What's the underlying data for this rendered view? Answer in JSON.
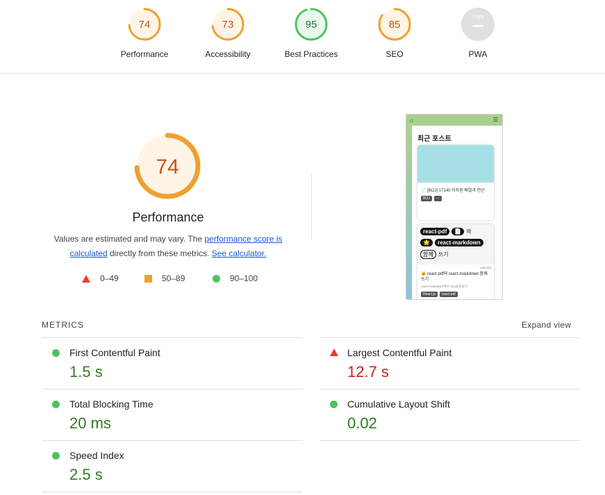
{
  "categories": [
    {
      "label": "Performance",
      "score": "74",
      "level": 0.74,
      "color": "#f0a030",
      "text_color": "#c0561b",
      "fill": "#fff4e6"
    },
    {
      "label": "Accessibility",
      "score": "73",
      "level": 0.73,
      "color": "#f0a030",
      "text_color": "#c0561b",
      "fill": "#fff4e6"
    },
    {
      "label": "Best Practices",
      "score": "95",
      "level": 0.95,
      "color": "#4dc45f",
      "text_color": "#1e7a35",
      "fill": "#e9f8ec"
    },
    {
      "label": "SEO",
      "score": "85",
      "level": 0.85,
      "color": "#f0a030",
      "text_color": "#c0561b",
      "fill": "#fff4e6"
    },
    {
      "label": "PWA",
      "badge": "PWA",
      "color": "#bdbdbd"
    }
  ],
  "hero": {
    "score": "74",
    "title": "Performance",
    "desc_prefix": "Values are estimated and may vary. The ",
    "desc_link": "performance score is calculated",
    "desc_middle": " directly from these metrics. ",
    "desc_link2": "See calculator."
  },
  "legend": {
    "fail": "0–49",
    "average": "50–89",
    "pass": "90–100"
  },
  "thumbnail": {
    "heading": "최근 포스트",
    "card1_title": "📄 [BOJ] 17140 이차원 배열과 연산",
    "card1_tags": [
      "BOJ",
      "···"
    ],
    "card2_pills": [
      "react-pdf",
      "📄",
      "와"
    ],
    "card2_pills2": [
      "🌟",
      "react-markdown"
    ],
    "card2_pills3": [
      "함께",
      "쓰기"
    ],
    "card2_date": "6/8/2023",
    "card2_title": "🐱 react-pdf와 react-markdown 함께 쓰기",
    "card2_sub": "react-markdown에서 내 pdf 만들기",
    "card2_tags": [
      "React.js",
      "react-pdf"
    ]
  },
  "metrics": {
    "heading": "METRICS",
    "expand": "Expand view",
    "items": [
      {
        "name": "First Contentful Paint",
        "value": "1.5 s",
        "status": "pass"
      },
      {
        "name": "Largest Contentful Paint",
        "value": "12.7 s",
        "status": "fail"
      },
      {
        "name": "Total Blocking Time",
        "value": "20 ms",
        "status": "pass"
      },
      {
        "name": "Cumulative Layout Shift",
        "value": "0.02",
        "status": "pass"
      },
      {
        "name": "Speed Index",
        "value": "2.5 s",
        "status": "pass"
      }
    ]
  }
}
